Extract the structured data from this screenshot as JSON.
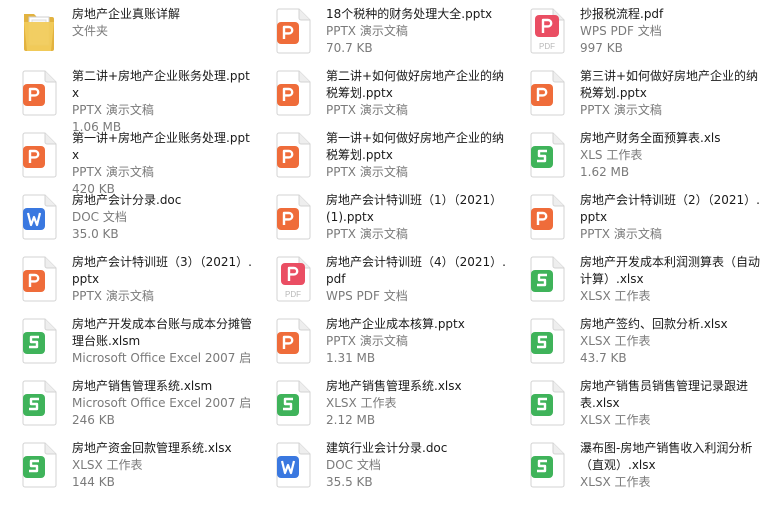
{
  "colors": {
    "ppt": "#ef6c3a",
    "pdf": "#ea4e63",
    "xls": "#3fb35a",
    "doc": "#3a78e0",
    "folder": "#f1cb5b"
  },
  "files": [
    {
      "name": "房地产企业真账详解",
      "type": "文件夹",
      "size": "",
      "icon": "folder-icon"
    },
    {
      "name": "18个税种的财务处理大全.pptx",
      "type": "PPTX 演示文稿",
      "size": "70.7 KB",
      "icon": "pptx-icon"
    },
    {
      "name": "抄报税流程.pdf",
      "type": "WPS PDF 文档",
      "size": "997 KB",
      "icon": "pdf-icon"
    },
    {
      "name": "第二讲+房地产企业账务处理.pptx",
      "type": "PPTX 演示文稿",
      "size": "1.06 MB",
      "icon": "pptx-icon"
    },
    {
      "name": "第二讲+如何做好房地产企业的纳税筹划.pptx",
      "type": "PPTX 演示文稿",
      "size": "",
      "icon": "pptx-icon"
    },
    {
      "name": "第三讲+如何做好房地产企业的纳税筹划.pptx",
      "type": "PPTX 演示文稿",
      "size": "",
      "icon": "pptx-icon"
    },
    {
      "name": "第一讲+房地产企业账务处理.pptx",
      "type": "PPTX 演示文稿",
      "size": "420 KB",
      "icon": "pptx-icon"
    },
    {
      "name": "第一讲+如何做好房地产企业的纳税筹划.pptx",
      "type": "PPTX 演示文稿",
      "size": "",
      "icon": "pptx-icon"
    },
    {
      "name": "房地产财务全面预算表.xls",
      "type": "XLS 工作表",
      "size": "1.62 MB",
      "icon": "xls-icon"
    },
    {
      "name": "房地产会计分录.doc",
      "type": "DOC 文档",
      "size": "35.0 KB",
      "icon": "doc-icon"
    },
    {
      "name": "房地产会计特训班（1）（2021）(1).pptx",
      "type": "PPTX 演示文稿",
      "size": "",
      "icon": "pptx-icon"
    },
    {
      "name": "房地产会计特训班（2）（2021）.pptx",
      "type": "PPTX 演示文稿",
      "size": "",
      "icon": "pptx-icon"
    },
    {
      "name": "房地产会计特训班（3）（2021）.pptx",
      "type": "PPTX 演示文稿",
      "size": "",
      "icon": "pptx-icon"
    },
    {
      "name": "房地产会计特训班（4）（2021）.pdf",
      "type": "WPS PDF 文档",
      "size": "",
      "icon": "pdf-icon"
    },
    {
      "name": "房地产开发成本利润测算表（自动计算）.xlsx",
      "type": "XLSX 工作表",
      "size": "",
      "icon": "xls-icon"
    },
    {
      "name": "房地产开发成本台账与成本分摊管理台账.xlsm",
      "type": "Microsoft Office Excel 2007 启...",
      "size": "",
      "icon": "xls-icon"
    },
    {
      "name": "房地产企业成本核算.pptx",
      "type": "PPTX 演示文稿",
      "size": "1.31 MB",
      "icon": "pptx-icon"
    },
    {
      "name": "房地产签约、回款分析.xlsx",
      "type": "XLSX 工作表",
      "size": "43.7 KB",
      "icon": "xls-icon"
    },
    {
      "name": "房地产销售管理系统.xlsm",
      "type": "Microsoft Office Excel 2007 启...",
      "size": "246 KB",
      "icon": "xls-icon"
    },
    {
      "name": "房地产销售管理系统.xlsx",
      "type": "XLSX 工作表",
      "size": "2.12 MB",
      "icon": "xls-icon"
    },
    {
      "name": "房地产销售员销售管理记录跟进表.xlsx",
      "type": "XLSX 工作表",
      "size": "",
      "icon": "xls-icon"
    },
    {
      "name": "房地产资金回款管理系统.xlsx",
      "type": "XLSX 工作表",
      "size": "144 KB",
      "icon": "xls-icon"
    },
    {
      "name": "建筑行业会计分录.doc",
      "type": "DOC 文档",
      "size": "35.5 KB",
      "icon": "doc-icon"
    },
    {
      "name": "瀑布图-房地产销售收入利润分析（直观）.xlsx",
      "type": "XLSX 工作表",
      "size": "",
      "icon": "xls-icon"
    }
  ]
}
